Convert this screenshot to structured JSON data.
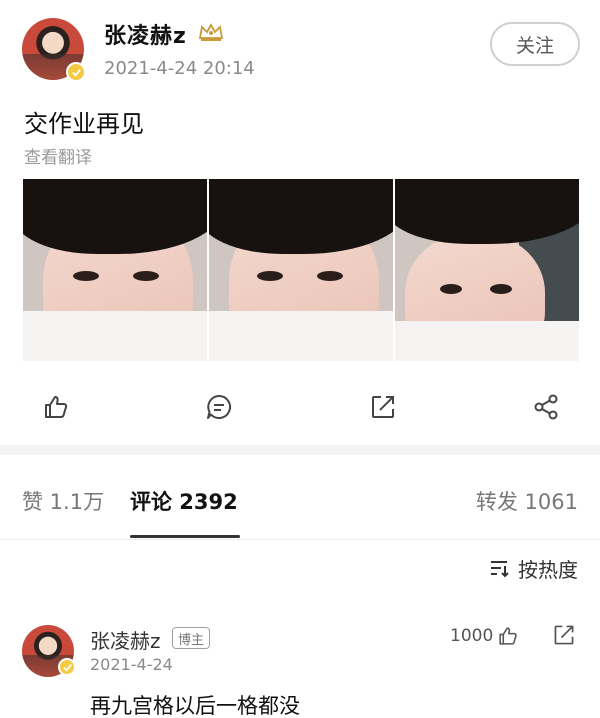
{
  "post": {
    "author": "张凌赫z",
    "timestamp": "2021-4-24 20:14",
    "follow_label": "关注",
    "text": "交作业再见",
    "translate_label": "查看翻译",
    "photos": [
      "photo-1",
      "photo-2",
      "photo-3"
    ]
  },
  "actions": {
    "icons": [
      "like-icon",
      "comment-icon",
      "repost-icon",
      "share-icon"
    ]
  },
  "tabs": {
    "likes": "赞 1.1万",
    "comments": "评论 2392",
    "reposts": "转发 1061",
    "active": "comments"
  },
  "sort": {
    "label": "按热度"
  },
  "comment": {
    "author": "张凌赫z",
    "author_tag": "博主",
    "date": "2021-4-24",
    "text": "再九宫格以后一格都没",
    "likes": "1000"
  },
  "colors": {
    "verified_badge": "#f6c943",
    "active_tab": "#111111",
    "muted_text": "#8a8a8a",
    "band": "#f4f4f4"
  }
}
